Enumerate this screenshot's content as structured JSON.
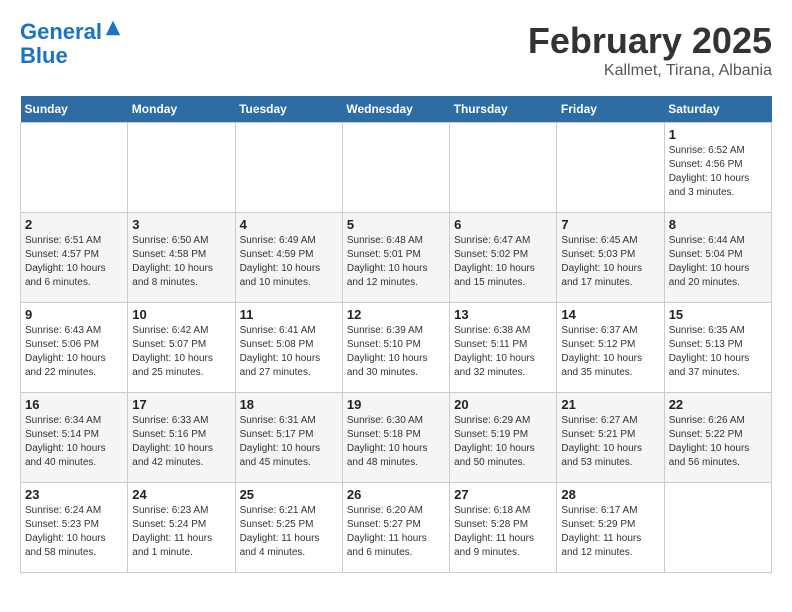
{
  "logo": {
    "line1": "General",
    "line2": "Blue"
  },
  "title": "February 2025",
  "subtitle": "Kallmet, Tirana, Albania",
  "weekdays": [
    "Sunday",
    "Monday",
    "Tuesday",
    "Wednesday",
    "Thursday",
    "Friday",
    "Saturday"
  ],
  "weeks": [
    [
      {
        "day": "",
        "info": ""
      },
      {
        "day": "",
        "info": ""
      },
      {
        "day": "",
        "info": ""
      },
      {
        "day": "",
        "info": ""
      },
      {
        "day": "",
        "info": ""
      },
      {
        "day": "",
        "info": ""
      },
      {
        "day": "1",
        "info": "Sunrise: 6:52 AM\nSunset: 4:56 PM\nDaylight: 10 hours\nand 3 minutes."
      }
    ],
    [
      {
        "day": "2",
        "info": "Sunrise: 6:51 AM\nSunset: 4:57 PM\nDaylight: 10 hours\nand 6 minutes."
      },
      {
        "day": "3",
        "info": "Sunrise: 6:50 AM\nSunset: 4:58 PM\nDaylight: 10 hours\nand 8 minutes."
      },
      {
        "day": "4",
        "info": "Sunrise: 6:49 AM\nSunset: 4:59 PM\nDaylight: 10 hours\nand 10 minutes."
      },
      {
        "day": "5",
        "info": "Sunrise: 6:48 AM\nSunset: 5:01 PM\nDaylight: 10 hours\nand 12 minutes."
      },
      {
        "day": "6",
        "info": "Sunrise: 6:47 AM\nSunset: 5:02 PM\nDaylight: 10 hours\nand 15 minutes."
      },
      {
        "day": "7",
        "info": "Sunrise: 6:45 AM\nSunset: 5:03 PM\nDaylight: 10 hours\nand 17 minutes."
      },
      {
        "day": "8",
        "info": "Sunrise: 6:44 AM\nSunset: 5:04 PM\nDaylight: 10 hours\nand 20 minutes."
      }
    ],
    [
      {
        "day": "9",
        "info": "Sunrise: 6:43 AM\nSunset: 5:06 PM\nDaylight: 10 hours\nand 22 minutes."
      },
      {
        "day": "10",
        "info": "Sunrise: 6:42 AM\nSunset: 5:07 PM\nDaylight: 10 hours\nand 25 minutes."
      },
      {
        "day": "11",
        "info": "Sunrise: 6:41 AM\nSunset: 5:08 PM\nDaylight: 10 hours\nand 27 minutes."
      },
      {
        "day": "12",
        "info": "Sunrise: 6:39 AM\nSunset: 5:10 PM\nDaylight: 10 hours\nand 30 minutes."
      },
      {
        "day": "13",
        "info": "Sunrise: 6:38 AM\nSunset: 5:11 PM\nDaylight: 10 hours\nand 32 minutes."
      },
      {
        "day": "14",
        "info": "Sunrise: 6:37 AM\nSunset: 5:12 PM\nDaylight: 10 hours\nand 35 minutes."
      },
      {
        "day": "15",
        "info": "Sunrise: 6:35 AM\nSunset: 5:13 PM\nDaylight: 10 hours\nand 37 minutes."
      }
    ],
    [
      {
        "day": "16",
        "info": "Sunrise: 6:34 AM\nSunset: 5:14 PM\nDaylight: 10 hours\nand 40 minutes."
      },
      {
        "day": "17",
        "info": "Sunrise: 6:33 AM\nSunset: 5:16 PM\nDaylight: 10 hours\nand 42 minutes."
      },
      {
        "day": "18",
        "info": "Sunrise: 6:31 AM\nSunset: 5:17 PM\nDaylight: 10 hours\nand 45 minutes."
      },
      {
        "day": "19",
        "info": "Sunrise: 6:30 AM\nSunset: 5:18 PM\nDaylight: 10 hours\nand 48 minutes."
      },
      {
        "day": "20",
        "info": "Sunrise: 6:29 AM\nSunset: 5:19 PM\nDaylight: 10 hours\nand 50 minutes."
      },
      {
        "day": "21",
        "info": "Sunrise: 6:27 AM\nSunset: 5:21 PM\nDaylight: 10 hours\nand 53 minutes."
      },
      {
        "day": "22",
        "info": "Sunrise: 6:26 AM\nSunset: 5:22 PM\nDaylight: 10 hours\nand 56 minutes."
      }
    ],
    [
      {
        "day": "23",
        "info": "Sunrise: 6:24 AM\nSunset: 5:23 PM\nDaylight: 10 hours\nand 58 minutes."
      },
      {
        "day": "24",
        "info": "Sunrise: 6:23 AM\nSunset: 5:24 PM\nDaylight: 11 hours\nand 1 minute."
      },
      {
        "day": "25",
        "info": "Sunrise: 6:21 AM\nSunset: 5:25 PM\nDaylight: 11 hours\nand 4 minutes."
      },
      {
        "day": "26",
        "info": "Sunrise: 6:20 AM\nSunset: 5:27 PM\nDaylight: 11 hours\nand 6 minutes."
      },
      {
        "day": "27",
        "info": "Sunrise: 6:18 AM\nSunset: 5:28 PM\nDaylight: 11 hours\nand 9 minutes."
      },
      {
        "day": "28",
        "info": "Sunrise: 6:17 AM\nSunset: 5:29 PM\nDaylight: 11 hours\nand 12 minutes."
      },
      {
        "day": "",
        "info": ""
      }
    ]
  ]
}
